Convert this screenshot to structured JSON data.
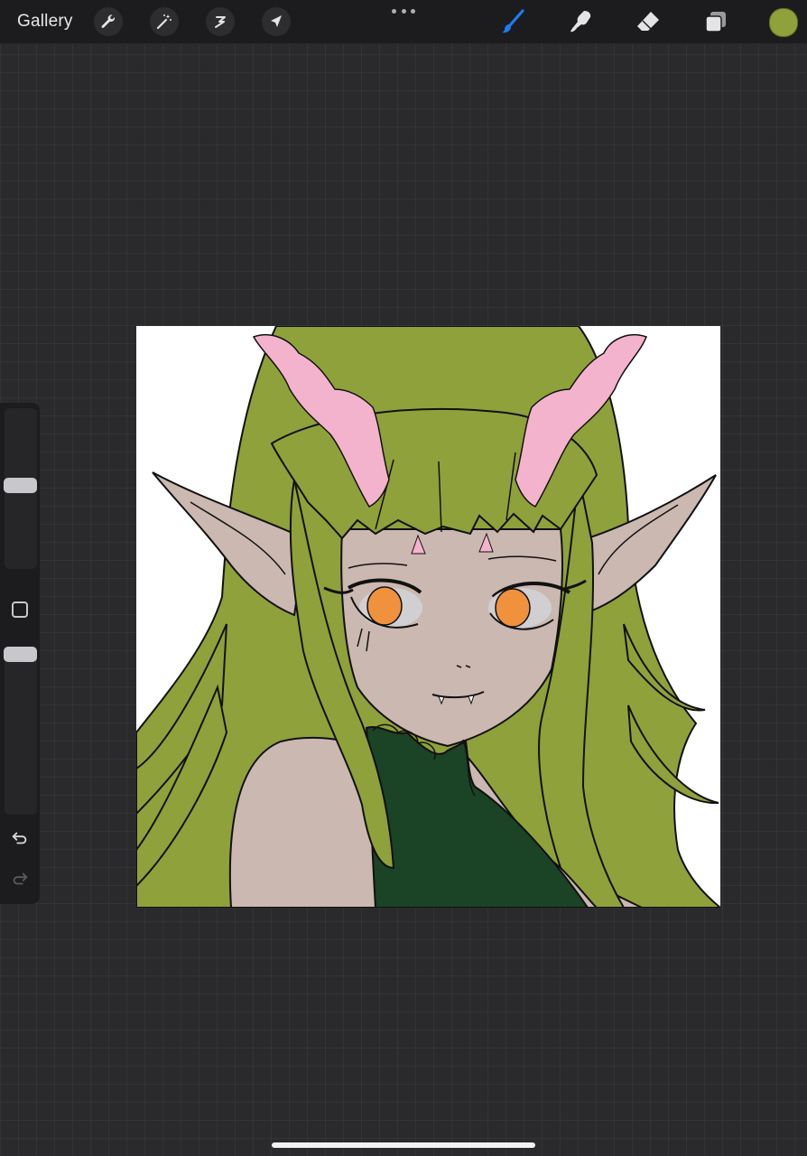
{
  "topbar": {
    "gallery_label": "Gallery",
    "left_tools": [
      {
        "name": "actions-icon"
      },
      {
        "name": "adjustments-icon"
      },
      {
        "name": "selection-icon"
      },
      {
        "name": "transform-icon"
      }
    ],
    "right_tools": [
      {
        "name": "brush-icon",
        "active": true
      },
      {
        "name": "smudge-icon",
        "active": false
      },
      {
        "name": "eraser-icon",
        "active": false
      },
      {
        "name": "layers-icon",
        "active": false
      }
    ],
    "current_color": "#8fa13a"
  },
  "sidebar": {
    "brush_size_level": 0.52,
    "opacity_level": 0.0
  },
  "colors": {
    "hair": "#8fa13a",
    "skin": "#cbb8b0",
    "horns": "#f4b3cc",
    "iris": "#f0913d",
    "dress": "#1b4326",
    "accent_active": "#1e7cf2"
  }
}
